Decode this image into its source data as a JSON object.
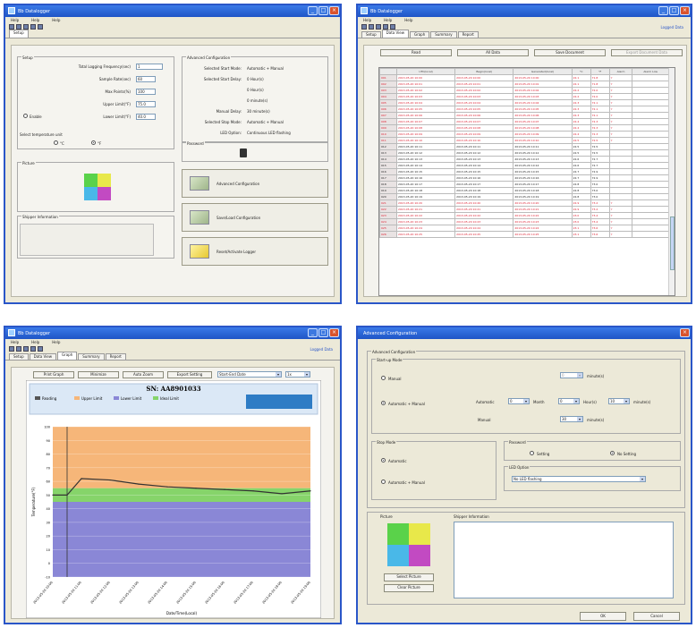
{
  "windows": {
    "w1": {
      "title": "Bb Datalogger",
      "menu": [
        "Help",
        "Help",
        "Help"
      ],
      "tab": "Setup",
      "setup": {
        "title": "Setup",
        "fields": [
          {
            "label": "Total Logging Frequency(sec)",
            "value": "1"
          },
          {
            "label": "Sample Rate(sec)",
            "value": "60"
          },
          {
            "label": "Max Points(%)",
            "value": "100"
          },
          {
            "label": "Upper Limit(°F)",
            "value": "75.0"
          },
          {
            "label": "Lower Limit(°F)",
            "value": "40.0"
          }
        ],
        "radio_label": "Enable",
        "temp_unit_label": "Select temperature unit",
        "unit_c": "°C",
        "unit_f": "°F"
      },
      "adv_summary": {
        "title": "Advanced Configuration",
        "rows": [
          {
            "k": "Selected Start Mode:",
            "v": "Automatic + Manual"
          },
          {
            "k": "Selected Start Delay:",
            "v": "0    Hour(s)"
          },
          {
            "k": "",
            "v": "0    Hour(s)"
          },
          {
            "k": "",
            "v": "0    minute(s)"
          },
          {
            "k": "Manual Delay:",
            "v": "30    minute(s)"
          },
          {
            "k": "Selected Stop Mode:",
            "v": "Automatic + Manual"
          },
          {
            "k": "LED Option:",
            "v": "Continuous LED flashing"
          }
        ]
      },
      "password_label": "Password",
      "picture_label": "Picture",
      "shipper_label": "Shipper Information",
      "buttons": [
        "Advanced Configuration",
        "Save/Load Configuration",
        "Reset/Activate Logger"
      ]
    },
    "w2": {
      "title": "Bb Datalogger",
      "menu": [
        "Help",
        "Help",
        "Help"
      ],
      "status": "Logged Data",
      "tabs": [
        "Setup",
        "Data View",
        "Graph",
        "Summary",
        "Report"
      ],
      "buttons": [
        "Read",
        "All Data",
        "Save Document",
        "Export Document Data"
      ],
      "columns": [
        "",
        "UTC(local)",
        "Begin(local)",
        "Generated(local)",
        "°C",
        "°F",
        "Alarm",
        "Alarm Low"
      ],
      "rows": [
        {
          "n": "001",
          "a": "2013-05-20 10:00",
          "b": "2013-05-20 10:00",
          "c": "2013-05-20 10:00",
          "t": "22.1",
          "f": "71.8",
          "x": "Y",
          "red": true
        },
        {
          "n": "002",
          "a": "2013-05-20 10:01",
          "b": "2013-05-20 10:01",
          "c": "2013-05-20 10:01",
          "t": "22.1",
          "f": "71.8",
          "x": "Y",
          "red": true
        },
        {
          "n": "003",
          "a": "2013-05-20 10:02",
          "b": "2013-05-20 10:02",
          "c": "2013-05-20 10:02",
          "t": "22.2",
          "f": "72.0",
          "x": "Y",
          "red": true
        },
        {
          "n": "004",
          "a": "2013-05-20 10:03",
          "b": "2013-05-20 10:03",
          "c": "2013-05-20 10:03",
          "t": "22.2",
          "f": "72.0",
          "x": "Y",
          "red": true
        },
        {
          "n": "005",
          "a": "2013-05-20 10:04",
          "b": "2013-05-20 10:04",
          "c": "2013-05-20 10:04",
          "t": "22.3",
          "f": "72.1",
          "x": "Y",
          "red": true
        },
        {
          "n": "006",
          "a": "2013-05-20 10:05",
          "b": "2013-05-20 10:05",
          "c": "2013-05-20 10:05",
          "t": "22.3",
          "f": "72.1",
          "x": "Y",
          "red": true
        },
        {
          "n": "007",
          "a": "2013-05-20 10:06",
          "b": "2013-05-20 10:06",
          "c": "2013-05-20 10:06",
          "t": "22.3",
          "f": "72.1",
          "x": "Y",
          "red": true
        },
        {
          "n": "008",
          "a": "2013-05-20 10:07",
          "b": "2013-05-20 10:07",
          "c": "2013-05-20 10:07",
          "t": "22.4",
          "f": "72.3",
          "x": "Y",
          "red": true
        },
        {
          "n": "009",
          "a": "2013-05-20 10:08",
          "b": "2013-05-20 10:08",
          "c": "2013-05-20 10:08",
          "t": "22.4",
          "f": "72.3",
          "x": "Y",
          "red": true
        },
        {
          "n": "010",
          "a": "2013-05-20 10:09",
          "b": "2013-05-20 10:09",
          "c": "2013-05-20 10:09",
          "t": "22.4",
          "f": "72.3",
          "x": "Y",
          "red": true
        },
        {
          "n": "011",
          "a": "2013-05-20 10:10",
          "b": "2013-05-20 10:10",
          "c": "2013-05-20 10:10",
          "t": "22.5",
          "f": "72.5",
          "x": "Y",
          "red": true
        },
        {
          "n": "012",
          "a": "2013-05-20 10:11",
          "b": "2013-05-20 10:11",
          "c": "2013-05-20 10:11",
          "t": "22.5",
          "f": "72.5",
          "x": "",
          "red": false
        },
        {
          "n": "013",
          "a": "2013-05-20 10:12",
          "b": "2013-05-20 10:12",
          "c": "2013-05-20 10:12",
          "t": "22.5",
          "f": "72.5",
          "x": "",
          "red": false
        },
        {
          "n": "014",
          "a": "2013-05-20 10:13",
          "b": "2013-05-20 10:13",
          "c": "2013-05-20 10:13",
          "t": "22.6",
          "f": "72.7",
          "x": "",
          "red": false
        },
        {
          "n": "015",
          "a": "2013-05-20 10:14",
          "b": "2013-05-20 10:14",
          "c": "2013-05-20 10:14",
          "t": "22.6",
          "f": "72.7",
          "x": "",
          "red": false
        },
        {
          "n": "016",
          "a": "2013-05-20 10:15",
          "b": "2013-05-20 10:15",
          "c": "2013-05-20 10:15",
          "t": "22.7",
          "f": "72.9",
          "x": "",
          "red": false
        },
        {
          "n": "017",
          "a": "2013-05-20 10:16",
          "b": "2013-05-20 10:16",
          "c": "2013-05-20 10:16",
          "t": "22.7",
          "f": "72.9",
          "x": "",
          "red": false
        },
        {
          "n": "018",
          "a": "2013-05-20 10:17",
          "b": "2013-05-20 10:17",
          "c": "2013-05-20 10:17",
          "t": "22.8",
          "f": "73.0",
          "x": "",
          "red": false
        },
        {
          "n": "019",
          "a": "2013-05-20 10:18",
          "b": "2013-05-20 10:18",
          "c": "2013-05-20 10:18",
          "t": "22.8",
          "f": "73.0",
          "x": "",
          "red": false
        },
        {
          "n": "020",
          "a": "2013-05-20 10:19",
          "b": "2013-05-20 10:19",
          "c": "2013-05-20 10:19",
          "t": "22.8",
          "f": "73.0",
          "x": "",
          "red": false
        },
        {
          "n": "021",
          "a": "2013-05-20 10:20",
          "b": "2013-05-20 10:20",
          "c": "2013-05-20 10:20",
          "t": "22.9",
          "f": "73.2",
          "x": "Y",
          "red": true
        },
        {
          "n": "022",
          "a": "2013-05-20 10:21",
          "b": "2013-05-20 10:21",
          "c": "2013-05-20 10:21",
          "t": "22.9",
          "f": "73.2",
          "x": "Y",
          "red": true
        },
        {
          "n": "023",
          "a": "2013-05-20 10:22",
          "b": "2013-05-20 10:22",
          "c": "2013-05-20 10:22",
          "t": "23.0",
          "f": "73.4",
          "x": "Y",
          "red": true
        },
        {
          "n": "024",
          "a": "2013-05-20 10:23",
          "b": "2013-05-20 10:23",
          "c": "2013-05-20 10:23",
          "t": "23.0",
          "f": "73.4",
          "x": "Y",
          "red": true
        },
        {
          "n": "025",
          "a": "2013-05-20 10:24",
          "b": "2013-05-20 10:24",
          "c": "2013-05-20 10:24",
          "t": "23.1",
          "f": "73.6",
          "x": "Y",
          "red": true
        },
        {
          "n": "026",
          "a": "2013-05-20 10:25",
          "b": "2013-05-20 10:25",
          "c": "2013-05-20 10:25",
          "t": "23.1",
          "f": "73.6",
          "x": "Y",
          "red": true
        }
      ]
    },
    "w3": {
      "title": "Bb Datalogger",
      "menu": [
        "Help",
        "Help",
        "Help"
      ],
      "status": "Logged Data",
      "tabs": [
        "Setup",
        "Data View",
        "Graph",
        "Summary",
        "Report"
      ],
      "tools": [
        "Print Graph",
        "Minimize",
        "Auto Zoom",
        "Export Setting"
      ],
      "range_select": "Start-End Date",
      "zoom_select": "1x",
      "graph_title": "SN: AA8901033",
      "legend": [
        "Reading",
        "Upper Limit",
        "Lower Limit",
        "Ideal Limit"
      ],
      "ylabel": "Temperature(°F)",
      "xlabel": "Date/Time(Local)",
      "yticks": [
        "100",
        "90",
        "80",
        "70",
        "60",
        "50",
        "40",
        "30",
        "20",
        "10",
        "0",
        "-10"
      ],
      "xticks": [
        "2013-05-20 10:00",
        "2013-05-20 11:00",
        "2013-05-20 12:00",
        "2013-05-20 13:00",
        "2013-05-20 14:00",
        "2013-05-20 15:00",
        "2013-05-20 16:00",
        "2013-05-20 17:00",
        "2013-05-20 18:00",
        "2013-05-20 19:00"
      ]
    },
    "w4": {
      "title": "Advanced Configuration",
      "section_title": "Advanced Configuration",
      "start_mode": {
        "label": "Start-up Mode",
        "manual": "Manual",
        "auto_manual": "Automatic + Manual",
        "automatic_label": "Automatic",
        "hours_a": "0",
        "hours_a_unit": "Month",
        "hours_b": "0",
        "hours_b_unit": "Hour(s)",
        "minutes": "10",
        "minutes_unit": "minute(s)",
        "top_minutes": "0",
        "top_minutes_unit": "minute(s)",
        "manual_label": "Manual",
        "manual_minutes": "30",
        "manual_minutes_unit": "minute(s)"
      },
      "stop_mode": {
        "label": "Stop Mode",
        "automatic": "Automatic",
        "auto_manual": "Automatic + Manual"
      },
      "password": {
        "label": "Password",
        "setting": "Setting",
        "no_setting": "No Setting"
      },
      "led": {
        "label": "LED Option",
        "value": "No LED flashing"
      },
      "picture": {
        "label": "Picture",
        "select": "Select Picture",
        "clear": "Clear Picture"
      },
      "shipper": {
        "label": "Shipper Information"
      },
      "ok": "OK",
      "cancel": "Cancel"
    }
  },
  "chart_data": {
    "type": "line",
    "title": "SN: AA8901033",
    "xlabel": "Date/Time(Local)",
    "ylabel": "Temperature(°F)",
    "ylim": [
      -10,
      100
    ],
    "series": [
      {
        "name": "Reading",
        "x": [
          "2013-05-20 10:00",
          "2013-05-20 10:30",
          "2013-05-20 11:00",
          "2013-05-20 12:00",
          "2013-05-20 13:00",
          "2013-05-20 14:00",
          "2013-05-20 15:00",
          "2013-05-20 16:00",
          "2013-05-20 17:00",
          "2013-05-20 18:00",
          "2013-05-20 19:00"
        ],
        "values": [
          50,
          50,
          62,
          61,
          58,
          56,
          55,
          54,
          53,
          51,
          53
        ]
      }
    ],
    "bands": [
      {
        "name": "Upper Limit",
        "from": 55,
        "to": 100,
        "color": "#f6b679"
      },
      {
        "name": "Ideal Limit",
        "from": 45,
        "to": 55,
        "color": "#86d46a"
      },
      {
        "name": "Lower Limit",
        "from": -10,
        "to": 45,
        "color": "#8a87d6"
      }
    ]
  }
}
